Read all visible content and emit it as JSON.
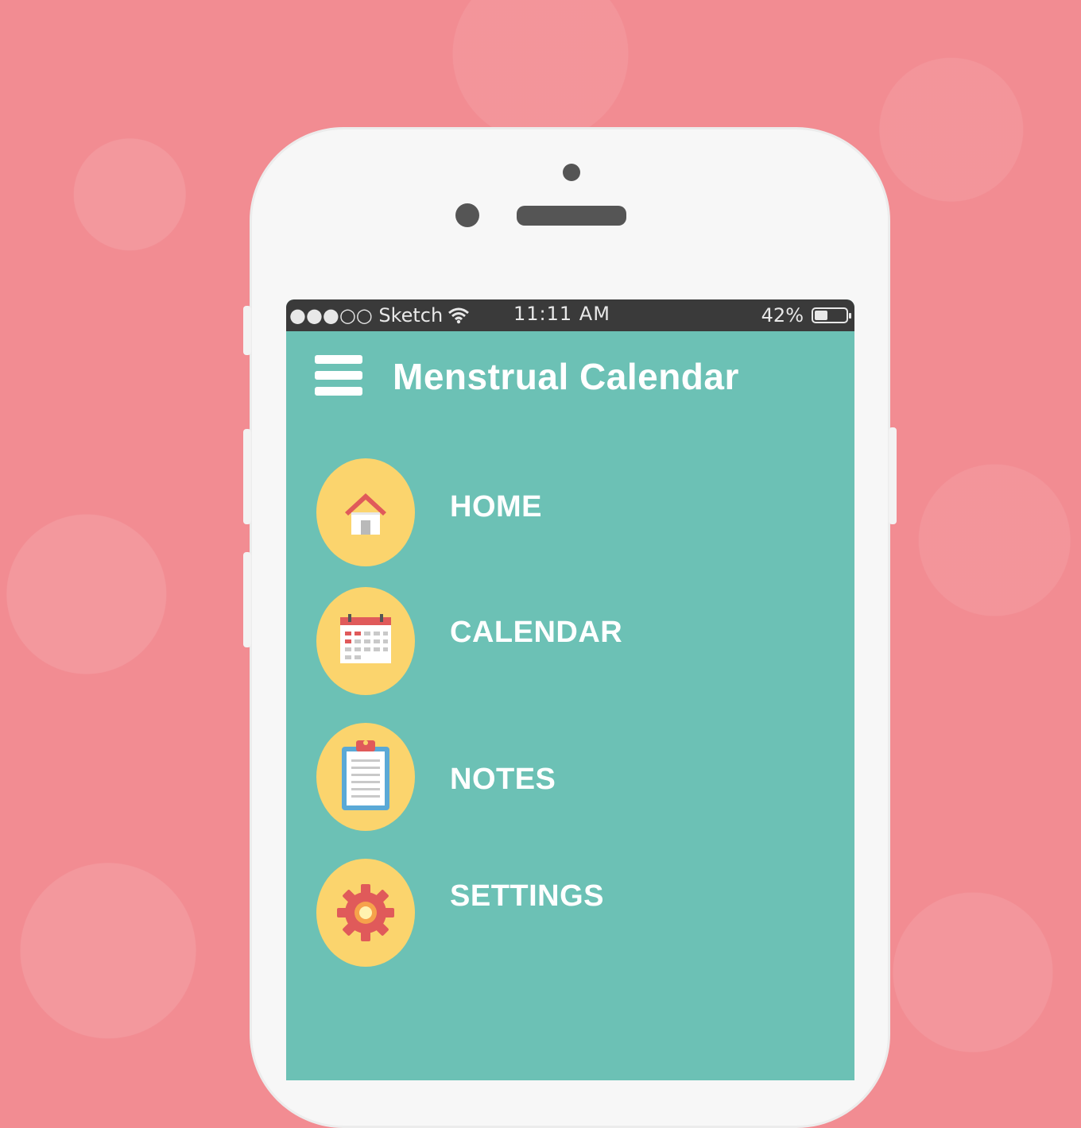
{
  "colors": {
    "background": "#f28c92",
    "screen": "#6cc1b5",
    "statusbar": "#3a3a3a",
    "icon_circle": "#fbd46d",
    "icon_red": "#e05a5a"
  },
  "statusbar": {
    "carrier": "●●●○○ Sketch",
    "time": "11:11 AM",
    "battery_text": "42%",
    "battery_level": 0.42
  },
  "header": {
    "title": "Menstrual Calendar",
    "menu_icon": "hamburger-menu-icon"
  },
  "nav": {
    "items": [
      {
        "label": "HOME",
        "icon": "home-icon"
      },
      {
        "label": "CALENDAR",
        "icon": "calendar-icon"
      },
      {
        "label": "NOTES",
        "icon": "notes-clipboard-icon"
      },
      {
        "label": "SETTINGS",
        "icon": "gear-icon"
      }
    ]
  }
}
